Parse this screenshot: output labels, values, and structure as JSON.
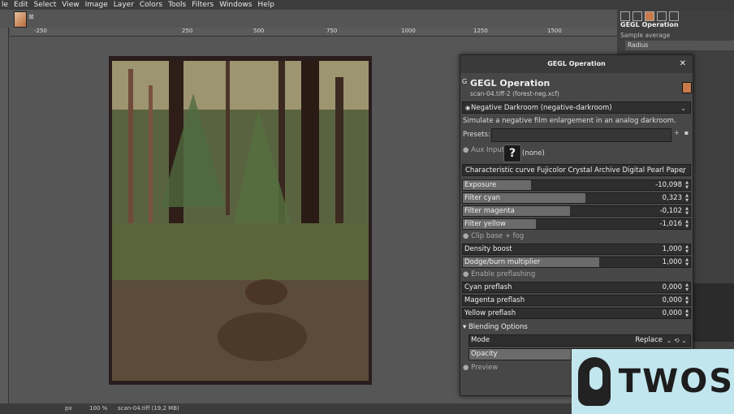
{
  "menu": [
    "le",
    "Edit",
    "Select",
    "View",
    "Image",
    "Layer",
    "Colors",
    "Tools",
    "Filters",
    "Windows",
    "Help"
  ],
  "ruler_ticks": [
    "-250",
    "250",
    "500",
    "750",
    "1000",
    "1250",
    "1500"
  ],
  "status": {
    "unit": "px",
    "zoom": "100 %",
    "file": "scan-04.tiff (19,2 MB)"
  },
  "dock": {
    "title": "GEGL Operation",
    "sample": "Sample average",
    "radius": "Radius"
  },
  "dialog": {
    "window_title": "GEGL Operation",
    "heading": "GEGL Operation",
    "subtitle": "scan-04.tiff-2 (forest-neg.xcf)",
    "operation": "Negative Darkroom (negative-darkroom)",
    "description": "Simulate a negative film enlargement in an analog darkroom.",
    "presets_label": "Presets:",
    "aux_label": "Aux Input",
    "aux_value": "(none)",
    "curve": "Characteristic curve Fujicolor Crystal Archive Digital Pearl Paper",
    "params": [
      {
        "label": "Exposure",
        "value": "-10,098",
        "level": 0.3
      },
      {
        "label": "Filter cyan",
        "value": "0,323",
        "level": 0.54
      },
      {
        "label": "Filter magenta",
        "value": "-0,102",
        "level": 0.47
      },
      {
        "label": "Filter yellow",
        "value": "-1,016",
        "level": 0.32
      }
    ],
    "clip_label": "Clip base + fog",
    "params2": [
      {
        "label": "Density boost",
        "value": "1,000",
        "level": 0
      },
      {
        "label": "Dodge/burn multiplier",
        "value": "1,000",
        "level": 0.6
      }
    ],
    "preflash_label": "Enable preflashing",
    "preflash": [
      {
        "label": "Cyan preflash",
        "value": "0,000"
      },
      {
        "label": "Magenta preflash",
        "value": "0,000"
      },
      {
        "label": "Yellow preflash",
        "value": "0,000"
      }
    ],
    "blending_label": "Blending Options",
    "mode_label": "Mode",
    "mode_value": "Replace",
    "opacity_label": "Opacity",
    "preview_label": "Preview"
  },
  "watermark": "TWOS"
}
